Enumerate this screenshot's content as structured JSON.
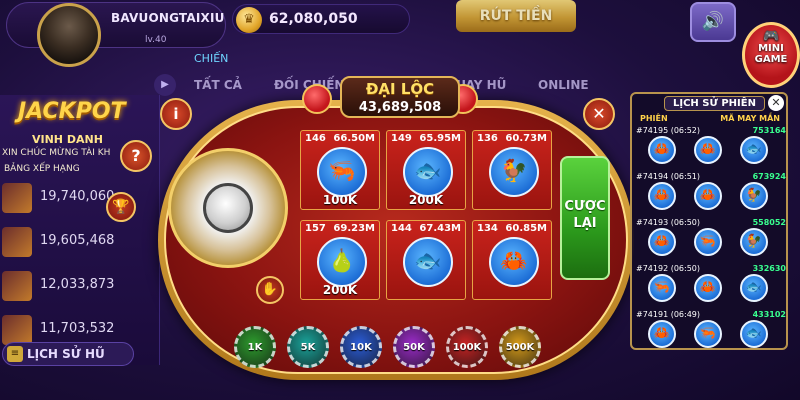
{
  "user": {
    "name": "BAVUONGTAIXIU",
    "level": "lv.40",
    "balance": "62,080,050"
  },
  "toolbar": {
    "withdraw_label": "RÚT TIỀN",
    "minigame_label": "MINI GAME"
  },
  "lobby": {
    "chien_label": "CHIẾN",
    "tabs": [
      "TẤT CẢ",
      "ĐỐI CHIẾN",
      "QUAY HŨ",
      "ONLINE"
    ]
  },
  "jackpot": {
    "title": "JACKPOT",
    "subtitle": "VINH DANH",
    "congrats": "XIN CHÚC MỪNG TÀI KH",
    "ranking": "BẢNG XẾP HẠNG",
    "amounts": [
      "19,740,060",
      "19,605,468",
      "12,033,873",
      "11,703,532"
    ],
    "history_label": "LỊCH SỬ HŨ"
  },
  "game": {
    "title": "ĐẠI LỘC",
    "pot": "43,689,508",
    "rebet_label": "CƯỢC LẠI",
    "cells": [
      {
        "count": "146",
        "total": "66.50M",
        "bet": "100K",
        "icon": "shrimp-icon",
        "glyph": "🦐",
        "color": "#2c7de0"
      },
      {
        "count": "149",
        "total": "65.95M",
        "bet": "200K",
        "icon": "fish-icon",
        "glyph": "🐟",
        "color": "#2c7de0"
      },
      {
        "count": "136",
        "total": "60.73M",
        "bet": "",
        "icon": "rooster-icon",
        "glyph": "🐓",
        "color": "#2c7de0"
      },
      {
        "count": "157",
        "total": "69.23M",
        "bet": "200K",
        "icon": "gourd-icon",
        "glyph": "🍐",
        "color": "#2c7de0"
      },
      {
        "count": "144",
        "total": "67.43M",
        "bet": "",
        "icon": "fish-icon",
        "glyph": "🐟",
        "color": "#2c7de0"
      },
      {
        "count": "134",
        "total": "60.85M",
        "bet": "",
        "icon": "crab-icon",
        "glyph": "🦀",
        "color": "#2c7de0"
      }
    ],
    "chips": [
      {
        "label": "1K",
        "color": "#2d9b2d"
      },
      {
        "label": "5K",
        "color": "#1aa39a"
      },
      {
        "label": "10K",
        "color": "#2b5cd6"
      },
      {
        "label": "50K",
        "color": "#9a2bc7"
      },
      {
        "label": "100K",
        "color": "#c62323"
      },
      {
        "label": "500K",
        "color": "#d49a1a"
      }
    ]
  },
  "history": {
    "title": "LỊCH SỬ PHIÊN",
    "col_round": "PHIÊN",
    "col_hash": "MÃ MAY MẮN",
    "rows": [
      {
        "id": "#74195 (06:52)",
        "hash": "753164",
        "icons": [
          "crab",
          "crab",
          "fish"
        ]
      },
      {
        "id": "#74194 (06:51)",
        "hash": "673924",
        "icons": [
          "crab",
          "crab",
          "rooster"
        ]
      },
      {
        "id": "#74193 (06:50)",
        "hash": "558052",
        "icons": [
          "crab",
          "shrimp",
          "rooster"
        ]
      },
      {
        "id": "#74192 (06:50)",
        "hash": "332630",
        "icons": [
          "shrimp",
          "crab",
          "fish"
        ]
      },
      {
        "id": "#74191 (06:49)",
        "hash": "433102",
        "icons": [
          "crab",
          "shrimp",
          "fish"
        ]
      }
    ]
  }
}
